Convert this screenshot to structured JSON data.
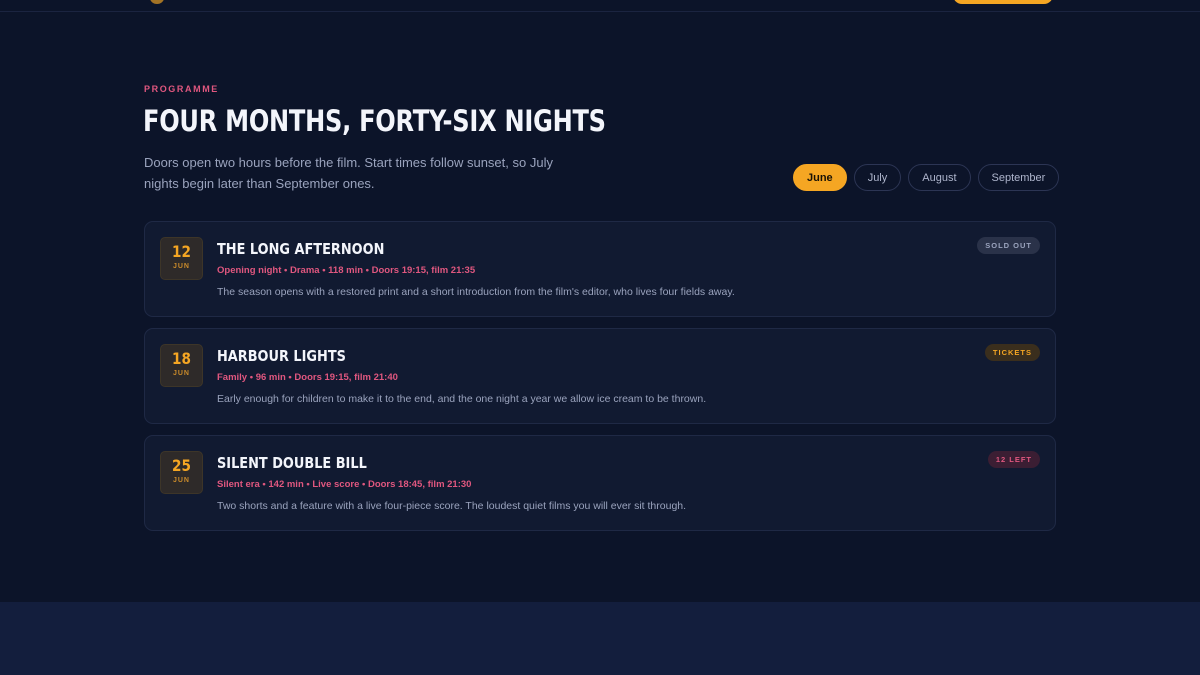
{
  "colors": {
    "background": "#0c1429",
    "accent": "#f5a623",
    "pink": "#e0577f",
    "card": "#111a31"
  },
  "section": {
    "eyebrow": "PROGRAMME",
    "title": "FOUR MONTHS, FORTY-SIX NIGHTS",
    "lede": "Doors open two hours before the film. Start times follow sunset, so July nights begin later than September ones."
  },
  "months": {
    "selected": "June",
    "tabs": [
      {
        "label": "June"
      },
      {
        "label": "July"
      },
      {
        "label": "August"
      },
      {
        "label": "September"
      }
    ]
  },
  "events": [
    {
      "day": "12",
      "month": "JUN",
      "title": "THE LONG AFTERNOON",
      "meta": "Opening night • Drama • 118 min • Doors 19:15, film 21:35",
      "description": "The season opens with a restored print and a short introduction from the film's editor, who lives four fields away.",
      "status": "SOLD OUT"
    },
    {
      "day": "18",
      "month": "JUN",
      "title": "HARBOUR LIGHTS",
      "meta": "Family • 96 min • Doors 19:15, film 21:40",
      "description": "Early enough for children to make it to the end, and the one night a year we allow ice cream to be thrown.",
      "status": "TICKETS"
    },
    {
      "day": "25",
      "month": "JUN",
      "title": "SILENT DOUBLE BILL",
      "meta": "Silent era • 142 min • Live score • Doors 18:45, film 21:30",
      "description": "Two shorts and a feature with a live four-piece score. The loudest quiet films you will ever sit through.",
      "status": "12 LEFT"
    }
  ]
}
